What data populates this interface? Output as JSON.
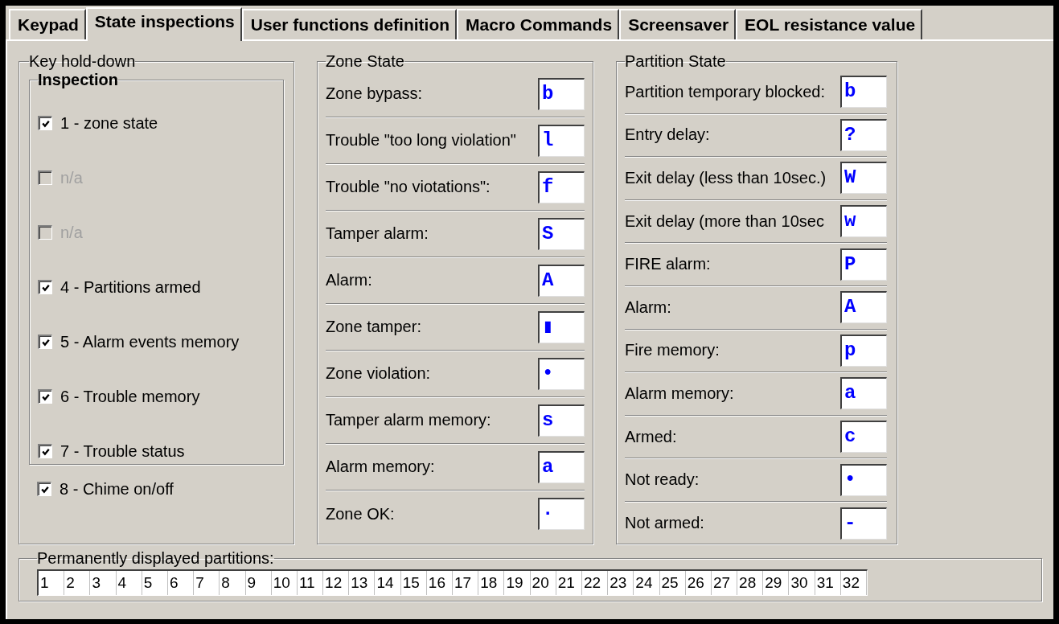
{
  "tabs": [
    {
      "label": "Keypad",
      "selected": false
    },
    {
      "label": "State inspections",
      "selected": true
    },
    {
      "label": "User functions definition",
      "selected": false
    },
    {
      "label": "Macro Commands",
      "selected": false
    },
    {
      "label": "Screensaver",
      "selected": false
    },
    {
      "label": "EOL resistance value",
      "selected": false
    }
  ],
  "key_hold_down": {
    "title": "Key hold-down",
    "inspection": {
      "title": "Inspection",
      "items": [
        {
          "label": "1 - zone state",
          "checked": true,
          "disabled": false
        },
        {
          "label": "n/a",
          "checked": false,
          "disabled": true
        },
        {
          "label": "n/a",
          "checked": false,
          "disabled": true
        },
        {
          "label": "4 - Partitions armed",
          "checked": true,
          "disabled": false
        },
        {
          "label": "5 - Alarm events memory",
          "checked": true,
          "disabled": false
        },
        {
          "label": "6 - Trouble memory",
          "checked": true,
          "disabled": false
        },
        {
          "label": "7 - Trouble status",
          "checked": true,
          "disabled": false
        }
      ]
    },
    "extra": {
      "label": "8 - Chime on/off",
      "checked": true,
      "disabled": false
    }
  },
  "zone_state": {
    "title": "Zone State",
    "rows": [
      {
        "label": "Zone bypass:",
        "value": "b"
      },
      {
        "label": "Trouble \"too long violation\"",
        "value": "l"
      },
      {
        "label": "Trouble \"no viotations\":",
        "value": "f"
      },
      {
        "label": "Tamper alarm:",
        "value": "S"
      },
      {
        "label": "Alarm:",
        "value": "A"
      },
      {
        "label": "Zone tamper:",
        "value": "▮"
      },
      {
        "label": "Zone violation:",
        "value": "•"
      },
      {
        "label": "Tamper alarm memory:",
        "value": "s"
      },
      {
        "label": "Alarm memory:",
        "value": "a"
      },
      {
        "label": "Zone OK:",
        "value": "·"
      }
    ]
  },
  "partition_state": {
    "title": "Partition State",
    "rows": [
      {
        "label": "Partition temporary blocked:",
        "value": "b"
      },
      {
        "label": "Entry delay:",
        "value": "?"
      },
      {
        "label": "Exit delay (less than 10sec.)",
        "value": "W"
      },
      {
        "label": "Exit delay (more than 10sec",
        "value": "w"
      },
      {
        "label": "FIRE alarm:",
        "value": "P"
      },
      {
        "label": "Alarm:",
        "value": "A"
      },
      {
        "label": "Fire memory:",
        "value": "p"
      },
      {
        "label": "Alarm memory:",
        "value": "a"
      },
      {
        "label": "Armed:",
        "value": "c"
      },
      {
        "label": "Not ready:",
        "value": "•"
      },
      {
        "label": "Not armed:",
        "value": "-"
      }
    ]
  },
  "permanent_partitions": {
    "title": "Permanently displayed partitions:",
    "cells": [
      "1",
      "2",
      "3",
      "4",
      "5",
      "6",
      "7",
      "8",
      "9",
      "10",
      "11",
      "12",
      "13",
      "14",
      "15",
      "16",
      "17",
      "18",
      "19",
      "20",
      "21",
      "22",
      "23",
      "24",
      "25",
      "26",
      "27",
      "28",
      "29",
      "30",
      "31",
      "32"
    ]
  }
}
